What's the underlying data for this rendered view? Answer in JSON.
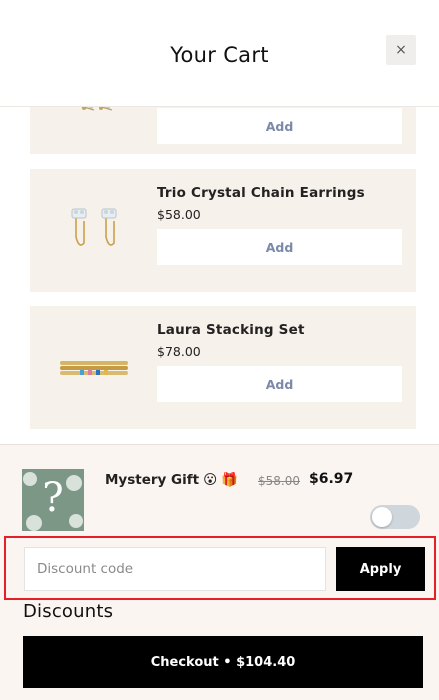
{
  "header": {
    "title": "Your Cart",
    "close_icon": "×"
  },
  "upsells": [
    {
      "name": "",
      "price": "",
      "add_label": "Add"
    },
    {
      "name": "Trio Crystal Chain Earrings",
      "price": "$58.00",
      "add_label": "Add"
    },
    {
      "name": "Laura Stacking Set",
      "price": "$78.00",
      "add_label": "Add"
    }
  ],
  "gift": {
    "title": "Mystery Gift",
    "emoji_face": "😮",
    "emoji_gift": "🎁",
    "old_price": "$58.00",
    "new_price": "$6.97",
    "question_mark": "?",
    "toggle_on": false
  },
  "discount": {
    "placeholder": "Discount code",
    "value": "",
    "apply_label": "Apply"
  },
  "discounts_label": "Discounts",
  "checkout_label": "Checkout • $104.40",
  "colors": {
    "card_bg": "#f7f1ec",
    "footer_bg": "#fbf5f1",
    "highlight": "#e61e25",
    "gift_bg": "#7d9787",
    "add_text": "#7a8aa8"
  }
}
